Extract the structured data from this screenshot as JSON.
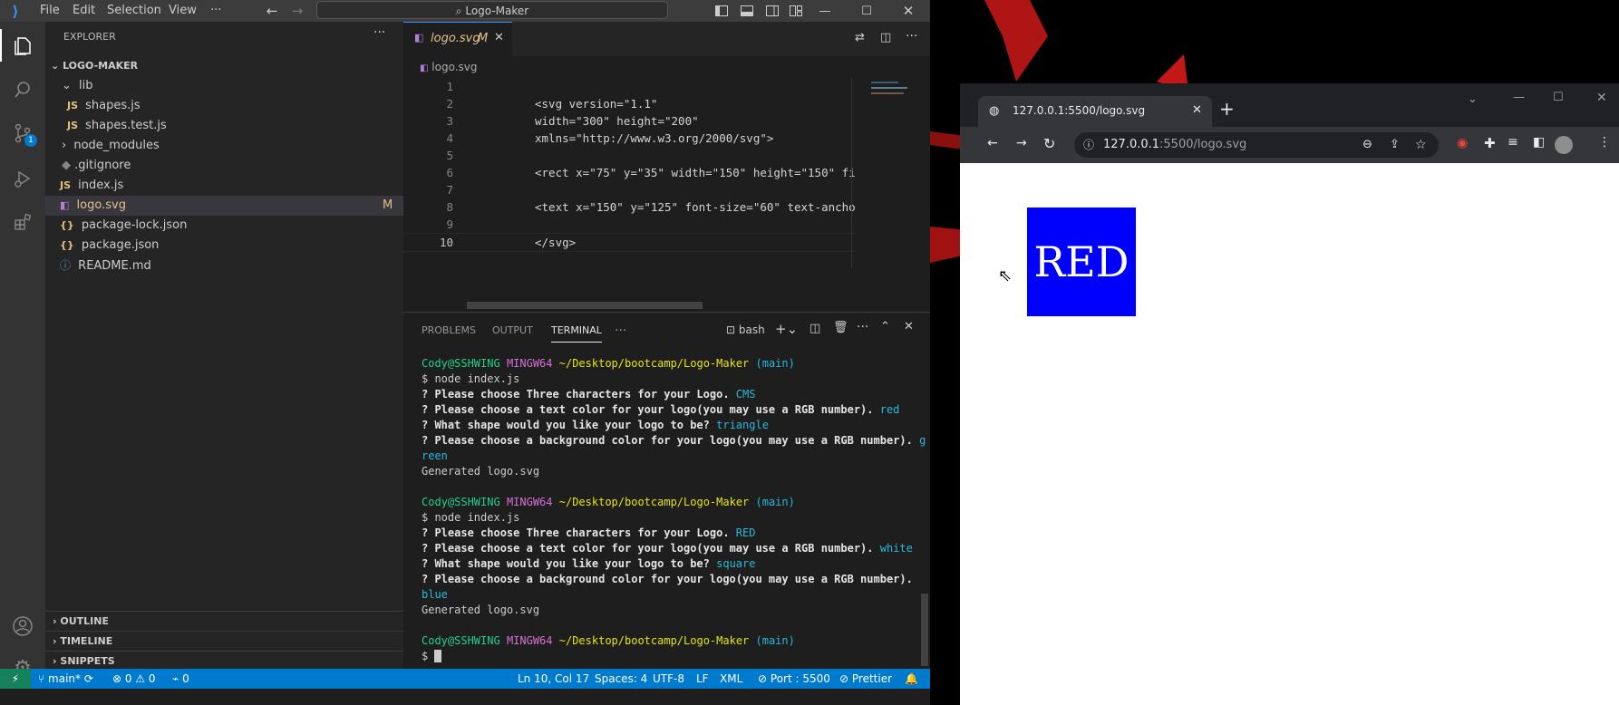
{
  "vscode": {
    "menu": [
      "File",
      "Edit",
      "Selection",
      "View",
      "···"
    ],
    "search": "Logo-Maker",
    "explorer_title": "EXPLORER",
    "project": "LOGO-MAKER",
    "tree": [
      {
        "label": "lib",
        "type": "folder-open"
      },
      {
        "label": "shapes.js",
        "type": "js"
      },
      {
        "label": "shapes.test.js",
        "type": "js"
      },
      {
        "label": "node_modules",
        "type": "folder"
      },
      {
        "label": ".gitignore",
        "type": "git"
      },
      {
        "label": "index.js",
        "type": "js"
      },
      {
        "label": "logo.svg",
        "type": "svg",
        "badge": "M"
      },
      {
        "label": "package-lock.json",
        "type": "json"
      },
      {
        "label": "package.json",
        "type": "json"
      },
      {
        "label": "README.md",
        "type": "info"
      }
    ],
    "sections": [
      "OUTLINE",
      "TIMELINE",
      "SNIPPETS"
    ],
    "tab": {
      "name": "logo.svg",
      "badge": "M"
    },
    "breadcrumb": "logo.svg",
    "code_lines": [
      {
        "n": "1",
        "t": ""
      },
      {
        "n": "2",
        "t": "<svg version=\"1.1\""
      },
      {
        "n": "3",
        "t": "width=\"300\" height=\"200\""
      },
      {
        "n": "4",
        "t": "xmlns=\"http://www.w3.org/2000/svg\">"
      },
      {
        "n": "5",
        "t": ""
      },
      {
        "n": "6",
        "t": "<rect x=\"75\" y=\"35\" width=\"150\" height=\"150\" fi"
      },
      {
        "n": "7",
        "t": ""
      },
      {
        "n": "8",
        "t": "<text x=\"150\" y=\"125\" font-size=\"60\" text-ancho"
      },
      {
        "n": "9",
        "t": ""
      },
      {
        "n": "10",
        "t": "</svg>"
      }
    ],
    "panel_tabs": [
      "PROBLEMS",
      "OUTPUT",
      "TERMINAL",
      "···"
    ],
    "shell": "bash",
    "terminal": [
      {
        "prompt": true,
        "user": "Cody@SSHWING",
        "sys": "MINGW64",
        "path": "~/Desktop/bootcamp/Logo-Maker",
        "branch": "(main)"
      },
      {
        "cmd": "$ node index.js"
      },
      {
        "q": "? Please choose Three characters for your Logo.",
        "a": "CMS"
      },
      {
        "q": "? Please choose a text color for your logo(you may use a RGB number).",
        "a": "red"
      },
      {
        "q": "? What shape would you like your logo to be?",
        "a": "triangle"
      },
      {
        "q": "? Please choose a background color for your logo(you may use a RGB number).",
        "a": "g"
      },
      {
        "cont": "reen"
      },
      {
        "out": "Generated logo.svg"
      },
      {
        "blank": true
      },
      {
        "prompt": true,
        "user": "Cody@SSHWING",
        "sys": "MINGW64",
        "path": "~/Desktop/bootcamp/Logo-Maker",
        "branch": "(main)"
      },
      {
        "cmd": "$ node index.js"
      },
      {
        "q": "? Please choose Three characters for your Logo.",
        "a": "RED"
      },
      {
        "q": "? Please choose a text color for your logo(you may use a RGB number).",
        "a": "white"
      },
      {
        "q": "? What shape would you like your logo to be?",
        "a": "square"
      },
      {
        "q": "? Please choose a background color for your logo(you may use a RGB number).",
        "a": ""
      },
      {
        "cont": "blue"
      },
      {
        "out": "Generated logo.svg"
      },
      {
        "blank": true
      },
      {
        "prompt": true,
        "user": "Cody@SSHWING",
        "sys": "MINGW64",
        "path": "~/Desktop/bootcamp/Logo-Maker",
        "branch": "(main)"
      },
      {
        "cmd": "$ "
      }
    ],
    "status": {
      "branch": "main*",
      "problems": "⊗ 0 ⚠ 0",
      "ports": "0",
      "pos": "Ln 10, Col 17",
      "spaces": "Spaces: 4",
      "encoding": "UTF-8",
      "eol": "LF",
      "lang": "XML",
      "port": "Port : 5500",
      "prettier": "Prettier"
    },
    "scm_badge": "1"
  },
  "browser": {
    "tab_title": "127.0.0.1:5500/logo.svg",
    "url_host": "127.0.0.1",
    "url_rest": ":5500/logo.svg",
    "logo_text": "RED",
    "logo_bg": "#0000ff"
  }
}
